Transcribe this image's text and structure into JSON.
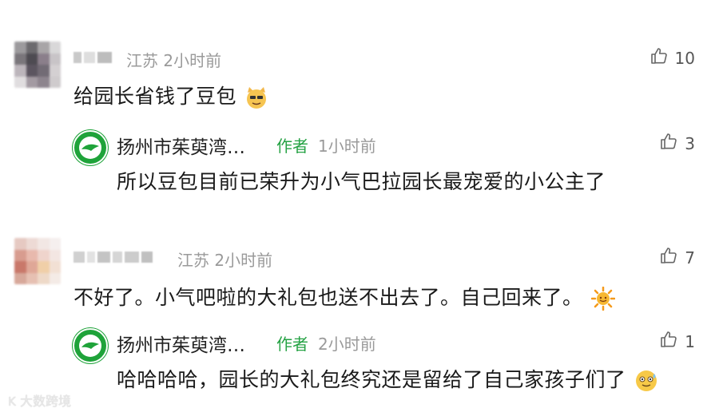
{
  "comments": [
    {
      "user": {
        "avatar": "blurred-avatar",
        "name_hidden": true
      },
      "location": "江苏",
      "time": "2小时前",
      "likes": "10",
      "text": "给园长省钱了豆包",
      "emoji": "cat-emoji",
      "reply": {
        "name": "扬州市茱萸湾…",
        "author_tag": "作者",
        "time": "1小时前",
        "likes": "3",
        "text": "所以豆包目前已荣升为小气巴拉园长最宠爱的小公主了"
      }
    },
    {
      "user": {
        "avatar": "blurred-avatar",
        "name_hidden": true
      },
      "location": "江苏",
      "time": "2小时前",
      "likes": "7",
      "text": "不好了。小气吧啦的大礼包也送不出去了。自己回来了。",
      "emoji": "sun-emoji",
      "reply": {
        "name": "扬州市茱萸湾…",
        "author_tag": "作者",
        "time": "2小时前",
        "likes": "1",
        "text": "哈哈哈哈，园长的大礼包终究还是留给了自己家孩子们了",
        "emoji": "sweat-smile-emoji"
      }
    }
  ],
  "watermark": "大数跨境",
  "colors": {
    "author_tag": "#25a244",
    "meta": "#9a9a9a",
    "logo_green": "#1fa33a"
  }
}
